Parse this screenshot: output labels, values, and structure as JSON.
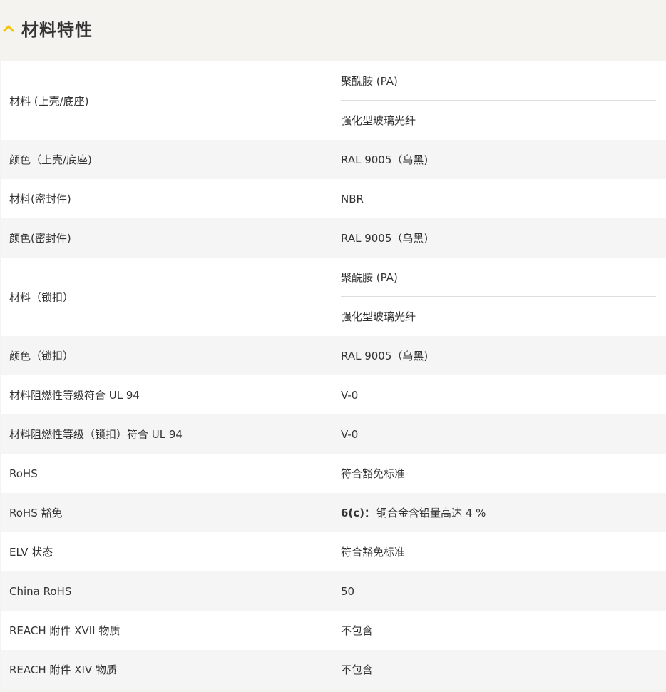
{
  "section": {
    "title": "材料特性",
    "expand_icon": "chevron-up-icon",
    "accent_color": "#f5c400"
  },
  "rows": [
    {
      "label": "材料 (上壳/底座)",
      "values": [
        "聚酰胺 (PA)",
        "强化型玻璃光纤"
      ]
    },
    {
      "label": "颜色（上壳/底座)",
      "values": [
        "RAL 9005（乌黑)"
      ]
    },
    {
      "label": "材料(密封件)",
      "values": [
        "NBR"
      ]
    },
    {
      "label": "颜色(密封件)",
      "values": [
        "RAL 9005（乌黑)"
      ]
    },
    {
      "label": "材料（锁扣）",
      "values": [
        "聚酰胺 (PA)",
        "强化型玻璃光纤"
      ]
    },
    {
      "label": "颜色（锁扣）",
      "values": [
        "RAL 9005（乌黑)"
      ]
    },
    {
      "label": "材料阻燃性等级符合 UL 94",
      "values": [
        "V-0"
      ]
    },
    {
      "label": "材料阻燃性等级（锁扣）符合 UL 94",
      "values": [
        "V-0"
      ]
    },
    {
      "label": "RoHS",
      "values": [
        "符合豁免标准"
      ]
    },
    {
      "label": "RoHS 豁免",
      "values": [
        "6(c)：铜合金含铅量高达 4 %"
      ],
      "value_bold_prefix": "6(c)："
    },
    {
      "label": "ELV 状态",
      "values": [
        "符合豁免标准"
      ]
    },
    {
      "label": "China RoHS",
      "values": [
        "50"
      ]
    },
    {
      "label": "REACH 附件 XVII 物质",
      "values": [
        "不包含"
      ]
    },
    {
      "label": "REACH 附件 XIV 物质",
      "values": [
        "不包含"
      ]
    }
  ]
}
